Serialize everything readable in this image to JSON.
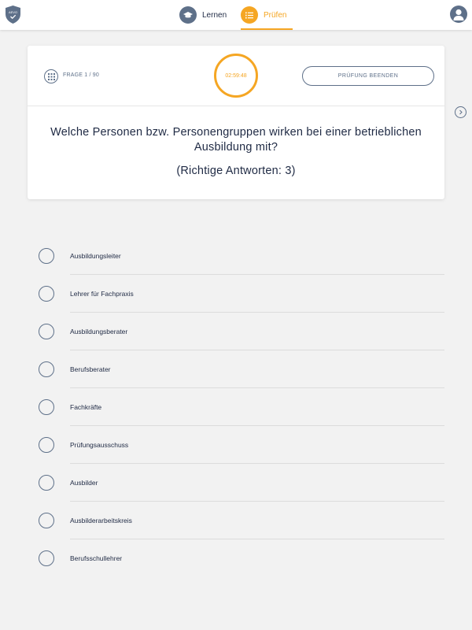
{
  "app": {
    "logo_text": "AEVO"
  },
  "nav": {
    "learn_label": "Lernen",
    "learn_icon": "graduation-cap-icon",
    "exam_label": "Prüfen",
    "exam_icon": "list-icon",
    "active": "exam"
  },
  "header": {
    "question_counter": "FRAGE 1 / 90",
    "timer": "02:59:48",
    "end_exam_label": "PRÜFUNG BEENDEN"
  },
  "question": {
    "text": "Welche Personen bzw. Personengruppen wirken bei einer betrieblichen Ausbildung mit?",
    "answer_count": "(Richtige Antworten: 3)"
  },
  "answers": [
    {
      "label": "Ausbildungsleiter",
      "selected": false
    },
    {
      "label": "Lehrer für Fachpraxis",
      "selected": false
    },
    {
      "label": "Ausbildungsberater",
      "selected": false
    },
    {
      "label": "Berufsberater",
      "selected": false
    },
    {
      "label": "Fachkräfte",
      "selected": false
    },
    {
      "label": "Prüfungsausschuss",
      "selected": false
    },
    {
      "label": "Ausbilder",
      "selected": false
    },
    {
      "label": "Ausbilderarbeitskreis",
      "selected": false
    },
    {
      "label": "Berufsschullehrer",
      "selected": false
    }
  ],
  "colors": {
    "accent": "#f5a623",
    "primary": "#5e7089",
    "text": "#1f2a44",
    "background": "#f2f2f2"
  }
}
